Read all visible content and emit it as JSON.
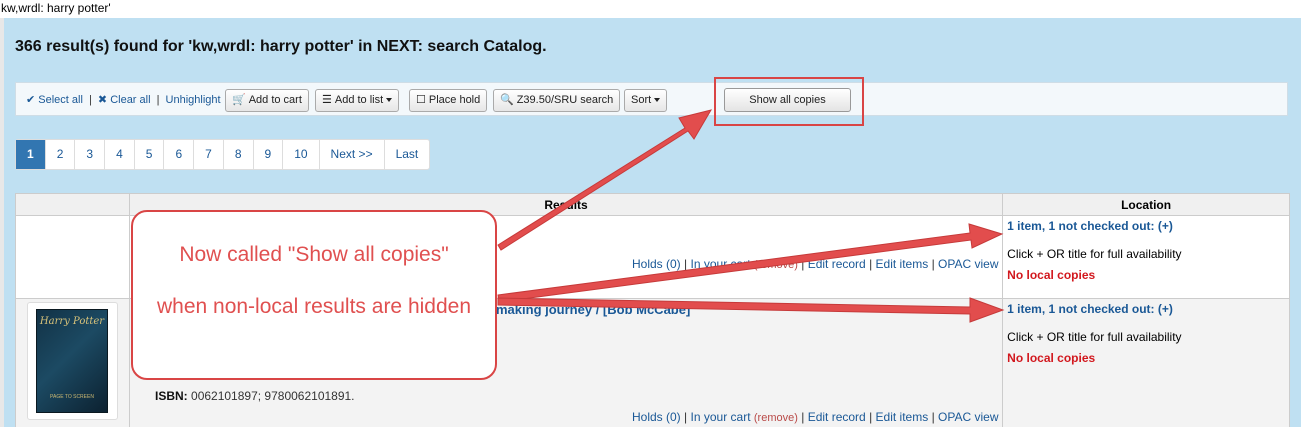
{
  "breadcrumb": "kw,wrdl: harry potter'",
  "heading": "366 result(s) found for 'kw,wrdl: harry potter' in NEXT: search Catalog.",
  "toolbar": {
    "select_all": "Select all",
    "clear_all": "Clear all",
    "unhighlight": "Unhighlight",
    "add_to_cart": "Add to cart",
    "add_to_list": "Add to list",
    "place_hold": "Place hold",
    "z3950": "Z39.50/SRU search",
    "sort": "Sort",
    "show_all_copies": "Show all copies"
  },
  "pagination": {
    "pages": [
      "1",
      "2",
      "3",
      "4",
      "5",
      "6",
      "7",
      "8",
      "9",
      "10"
    ],
    "next": "Next >>",
    "last": "Last",
    "current": "1"
  },
  "table": {
    "col_results": "Results",
    "col_location": "Location"
  },
  "rows": [
    {
      "holds": "Holds (0)",
      "cart": "In your cart",
      "remove": "(remove)",
      "edit_record": "Edit record",
      "edit_items": "Edit items",
      "opac": "OPAC view",
      "availability": "1 item, 1 not checked out: (+)",
      "availability_note": "Click + OR title for full availability",
      "no_local": "No local copies"
    },
    {
      "title_fragment": "making journey / [Bob McCabe]",
      "isbn_label": "ISBN:",
      "isbn": "0062101897; 9780062101891.",
      "holds": "Holds (0)",
      "cart": "In your cart",
      "remove": "(remove)",
      "edit_record": "Edit record",
      "edit_items": "Edit items",
      "opac": "OPAC view",
      "availability": "1 item, 1 not checked out: (+)",
      "availability_note": "Click + OR title for full availability",
      "no_local": "No local copies",
      "cover_title": "Harry Potter",
      "cover_subtitle": "PAGE TO SCREEN"
    }
  ],
  "callout": {
    "line1": "Now called \"Show all copies\"",
    "line2": "when non-local results are hidden"
  },
  "colors": {
    "background": "#bfe0f2",
    "link": "#1a5896",
    "pager_active": "#3276b1",
    "annotation": "#d94545",
    "no_local": "#d2181e"
  }
}
